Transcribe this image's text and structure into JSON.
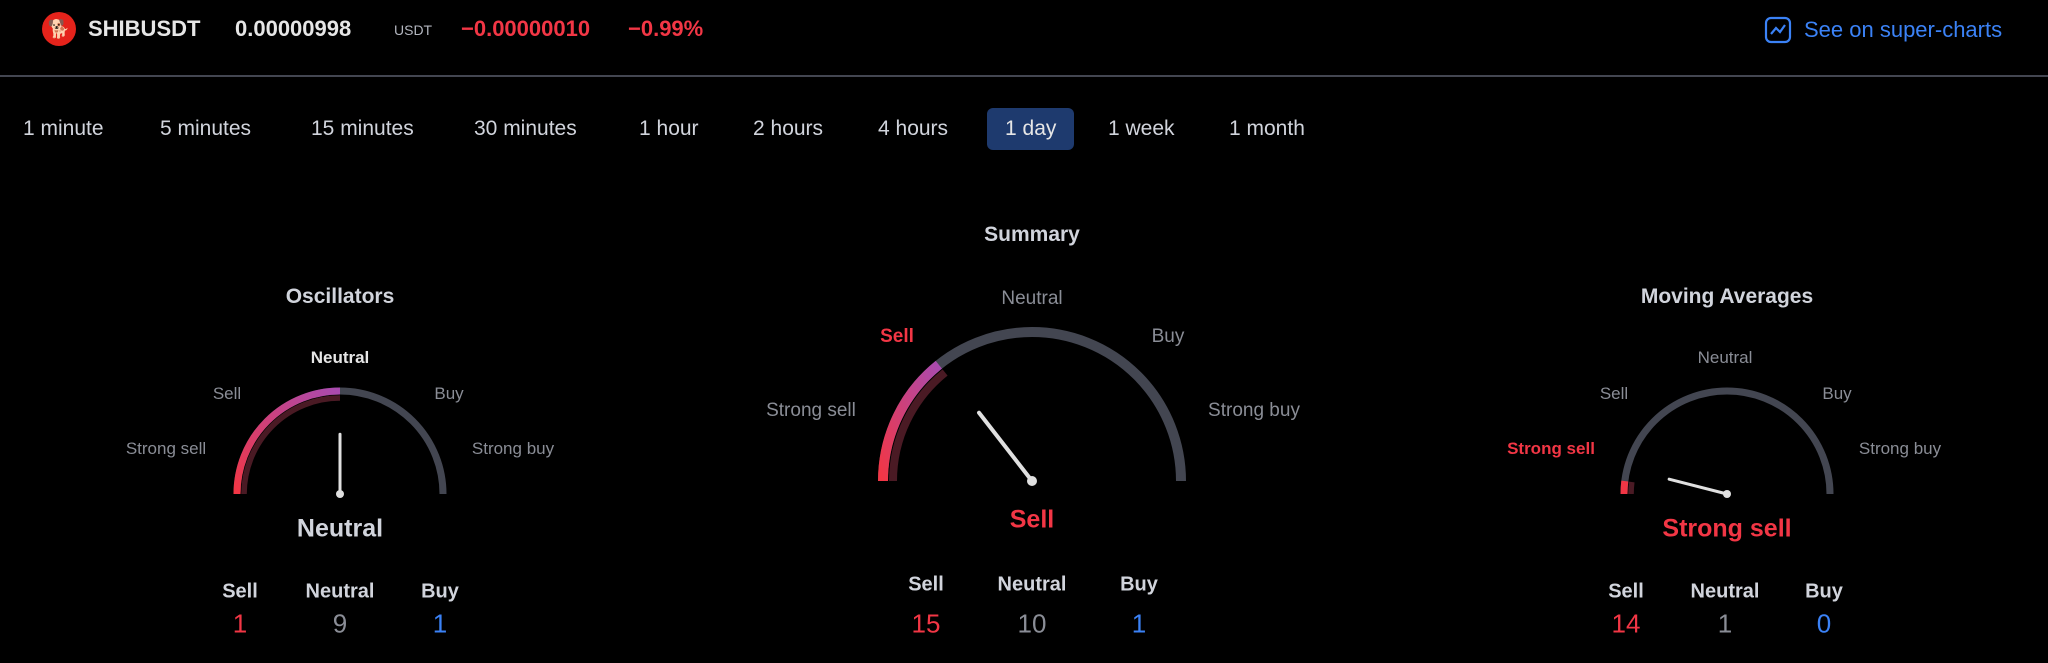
{
  "header": {
    "logo_icon": "shiba-inu-logo",
    "symbol": "SHIBUSDT",
    "price": "0.00000998",
    "currency": "USDT",
    "change": "−0.00000010",
    "change_percent": "−0.99%",
    "super_charts_icon": "chart-line-icon",
    "super_charts_label": "See on super-charts"
  },
  "tabs": [
    {
      "label": "1 minute"
    },
    {
      "label": "5 minutes"
    },
    {
      "label": "15 minutes"
    },
    {
      "label": "30 minutes"
    },
    {
      "label": "1 hour"
    },
    {
      "label": "2 hours"
    },
    {
      "label": "4 hours"
    },
    {
      "label": "1 day",
      "active": true
    },
    {
      "label": "1 week"
    },
    {
      "label": "1 month"
    }
  ],
  "colors": {
    "sell": "#f23645",
    "buy": "#3b82f6",
    "neutral": "#8a8d96",
    "track": "#434651",
    "accent": "#1e3a6e"
  },
  "gauges": [
    {
      "title": "Oscillators",
      "scale": {
        "strong_sell": "Strong sell",
        "sell": "Sell",
        "neutral": "Neutral",
        "buy": "Buy",
        "strong_buy": "Strong buy"
      },
      "highlighted": "neutral",
      "result": "Neutral",
      "needle": 0.0,
      "fill_to": 0.0,
      "counts": {
        "sell_label": "Sell",
        "neutral_label": "Neutral",
        "buy_label": "Buy",
        "sell": "1",
        "neutral": "9",
        "buy": "1"
      }
    },
    {
      "title": "Summary",
      "scale": {
        "strong_sell": "Strong sell",
        "sell": "Sell",
        "neutral": "Neutral",
        "buy": "Buy",
        "strong_buy": "Strong buy"
      },
      "highlighted": "sell",
      "result": "Sell",
      "needle": -0.42,
      "fill_to": -0.43,
      "counts": {
        "sell_label": "Sell",
        "neutral_label": "Neutral",
        "buy_label": "Buy",
        "sell": "15",
        "neutral": "10",
        "buy": "1"
      }
    },
    {
      "title": "Moving Averages",
      "scale": {
        "strong_sell": "Strong sell",
        "sell": "Sell",
        "neutral": "Neutral",
        "buy": "Buy",
        "strong_buy": "Strong buy"
      },
      "highlighted": "strong_sell",
      "result": "Strong sell",
      "needle": -0.84,
      "fill_to": -0.92,
      "counts": {
        "sell_label": "Sell",
        "neutral_label": "Neutral",
        "buy_label": "Buy",
        "sell": "14",
        "neutral": "1",
        "buy": "0"
      }
    }
  ]
}
